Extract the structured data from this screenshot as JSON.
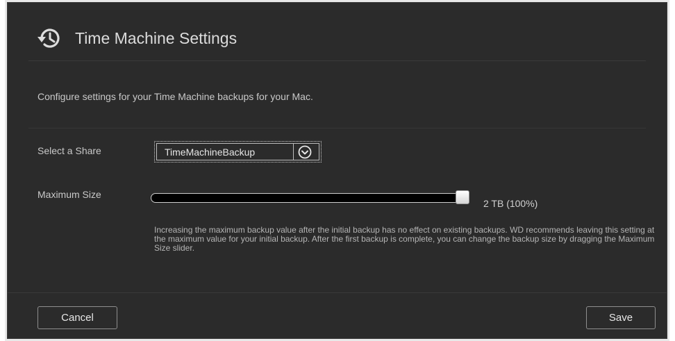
{
  "dialog": {
    "title": "Time Machine Settings",
    "title_icon": "history-clock-icon",
    "description": "Configure settings for your Time Machine backups for your Mac."
  },
  "share": {
    "label": "Select a Share",
    "selected": "TimeMachineBackup",
    "dropdown_icon": "chevron-down-circle-icon"
  },
  "max_size": {
    "label": "Maximum Size",
    "value_text": "2 TB (100%)",
    "level_percent": 100,
    "help_text": "Increasing the maximum backup value after the initial backup has no effect on existing backups. WD recommends leaving this setting at the maximum value for your initial backup. After the first backup is complete, you can change the backup size by dragging the Maximum Size slider."
  },
  "footer": {
    "cancel_label": "Cancel",
    "save_label": "Save"
  },
  "colors": {
    "dialog_bg": "#2b2b2b",
    "text": "#c9c9c9",
    "slider_track": "#000000"
  }
}
